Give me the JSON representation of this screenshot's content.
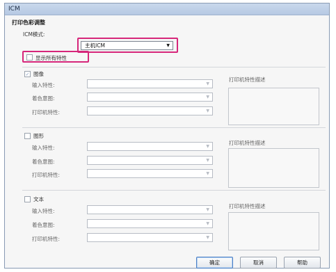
{
  "window": {
    "title": "ICM"
  },
  "print_color_adjust": {
    "caption": "打印色彩调整",
    "icm_mode_label": "ICM模式:",
    "icm_mode_value": "主机ICM",
    "show_all_profiles_label": "显示所有特性"
  },
  "sections": [
    {
      "title": "图像",
      "checked": true,
      "input_profile_label": "输入特性:",
      "rendering_intent_label": "着色意图:",
      "printer_profile_label": "打印机特性:",
      "description_label": "打印机特性描述"
    },
    {
      "title": "图形",
      "checked": false,
      "input_profile_label": "输入特性:",
      "rendering_intent_label": "着色意图:",
      "printer_profile_label": "打印机特性:",
      "description_label": "打印机特性描述"
    },
    {
      "title": "文本",
      "checked": false,
      "input_profile_label": "输入特性:",
      "rendering_intent_label": "着色意图:",
      "printer_profile_label": "打印机特性:",
      "description_label": "打印机特性描述"
    }
  ],
  "buttons": {
    "ok": "确定",
    "cancel": "取消",
    "help": "帮助"
  },
  "colors": {
    "highlight": "#d6267a",
    "default_button_border": "#4a7ec4"
  },
  "icons": {
    "dropdown": "chevron-down-icon",
    "checkmark": "checkmark-icon"
  }
}
